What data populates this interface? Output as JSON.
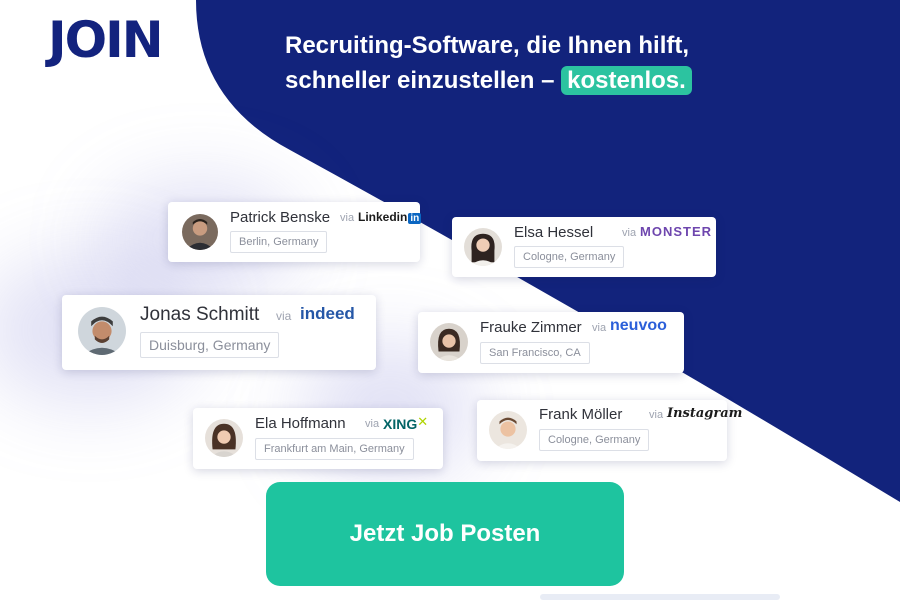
{
  "logo": {
    "text": "JOIN"
  },
  "headline": {
    "line1": "Recruiting-Software, die Ihnen hilft,",
    "line2": "schneller einzustellen –",
    "accent": "kostenlos."
  },
  "via_label": "via",
  "candidates": [
    {
      "name": "Patrick Benske",
      "location": "Berlin, Germany",
      "source": "Linkedin",
      "source_badge": "in"
    },
    {
      "name": "Elsa Hessel",
      "location": "Cologne, Germany",
      "source": "MONSTER"
    },
    {
      "name": "Jonas Schmitt",
      "location": "Duisburg, Germany",
      "source": "indeed"
    },
    {
      "name": "Frauke Zimmer",
      "location": "San Francisco, CA",
      "source": "neuvoo"
    },
    {
      "name": "Ela Hoffmann",
      "location": "Frankfurt am Main, Germany",
      "source": "XING"
    },
    {
      "name": "Frank Möller",
      "location": "Cologne, Germany",
      "source": "Instagram"
    }
  ],
  "cta": {
    "label": "Jetzt Job Posten"
  },
  "colors": {
    "navy": "#12237c",
    "accent_teal": "#1ec49f",
    "monster_purple": "#6e46ae",
    "indeed_blue": "#2557a7",
    "neuvoo_blue": "#2b5fd9",
    "xing_teal": "#026466",
    "xing_green": "#b0d400"
  }
}
